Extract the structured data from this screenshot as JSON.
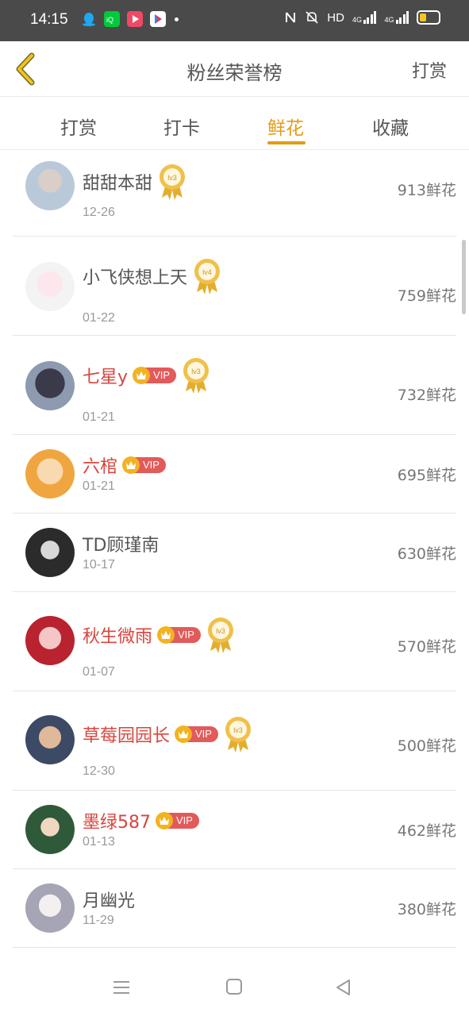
{
  "status": {
    "time": "14:15",
    "network_label": "HD",
    "signal1": "4G",
    "signal2": "4G"
  },
  "header": {
    "title": "粉丝荣誉榜",
    "action": "打赏"
  },
  "tabs": [
    {
      "label": "打赏"
    },
    {
      "label": "打卡"
    },
    {
      "label": "鲜花"
    },
    {
      "label": "收藏"
    }
  ],
  "active_tab_color": "#e69a16",
  "vip_label": "VIP",
  "entries": [
    {
      "name": "甜甜本甜",
      "date": "12-26",
      "amount": "913鲜花",
      "vip": false,
      "level": "lv3"
    },
    {
      "name": "小飞侠想上天",
      "date": "01-22",
      "amount": "759鲜花",
      "vip": false,
      "level": "lv4"
    },
    {
      "name": "七星y",
      "date": "01-21",
      "amount": "732鲜花",
      "vip": true,
      "level": "lv3"
    },
    {
      "name": "六棺",
      "date": "01-21",
      "amount": "695鲜花",
      "vip": true,
      "level": ""
    },
    {
      "name": "TD顾瑾南",
      "date": "10-17",
      "amount": "630鲜花",
      "vip": false,
      "level": ""
    },
    {
      "name": "秋生微雨",
      "date": "01-07",
      "amount": "570鲜花",
      "vip": true,
      "level": "lv3"
    },
    {
      "name": "草莓园园长",
      "date": "12-30",
      "amount": "500鲜花",
      "vip": true,
      "level": "lv3"
    },
    {
      "name": "墨绿587",
      "date": "01-13",
      "amount": "462鲜花",
      "vip": true,
      "level": ""
    },
    {
      "name": "月幽光",
      "date": "11-29",
      "amount": "380鲜花",
      "vip": false,
      "level": ""
    }
  ]
}
